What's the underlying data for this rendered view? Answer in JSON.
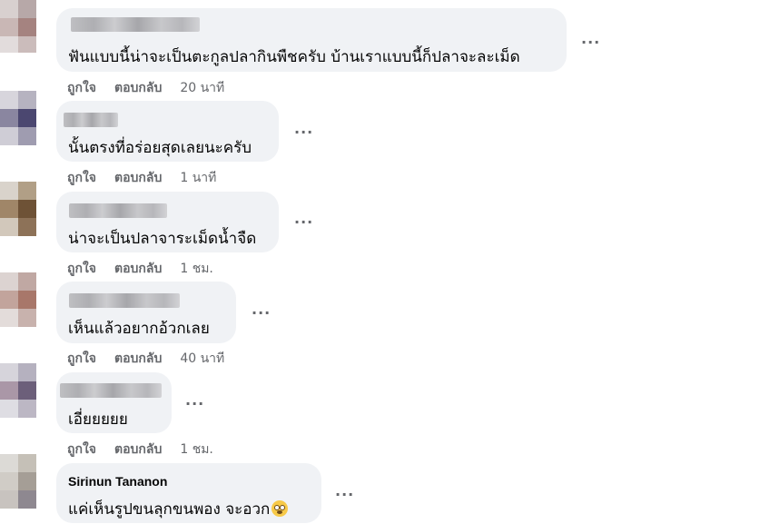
{
  "comments": [
    {
      "author": "",
      "text": "ฟันแบบนี้น่าจะเป็นตะกูลปลากินพืชครับ บ้านเราแบบนี้ก็ปลาจะละเม็ด",
      "like": "ถูกใจ",
      "reply": "ตอบกลับ",
      "time": "20 นาที",
      "more": "···"
    },
    {
      "author": "",
      "text": "นั้นตรงที่อร่อยสุดเลยนะครับ",
      "like": "ถูกใจ",
      "reply": "ตอบกลับ",
      "time": "1 นาที",
      "more": "···"
    },
    {
      "author": "",
      "text": "น่าจะเป็นปลาจาระเม็ดน้ำจืด",
      "like": "ถูกใจ",
      "reply": "ตอบกลับ",
      "time": "1 ชม.",
      "more": "···"
    },
    {
      "author": "",
      "text": "เห็นแล้วอยากอ้วกเลย",
      "like": "ถูกใจ",
      "reply": "ตอบกลับ",
      "time": "40 นาที",
      "more": "···"
    },
    {
      "author": "",
      "text": "เอี่ยยยยย",
      "like": "ถูกใจ",
      "reply": "ตอบกลับ",
      "time": "1 ชม.",
      "more": "···"
    },
    {
      "author": "Sirinun Tananon",
      "text": "แค่เห็นรูปขนลุกขนพอง จะอวก",
      "emoji": "fearful-face-emoji",
      "more": "···"
    }
  ],
  "colors": {
    "bubble": "#f0f2f5",
    "meta_text": "#65676b",
    "body_text": "#050505",
    "emoji": "#f7c948"
  }
}
